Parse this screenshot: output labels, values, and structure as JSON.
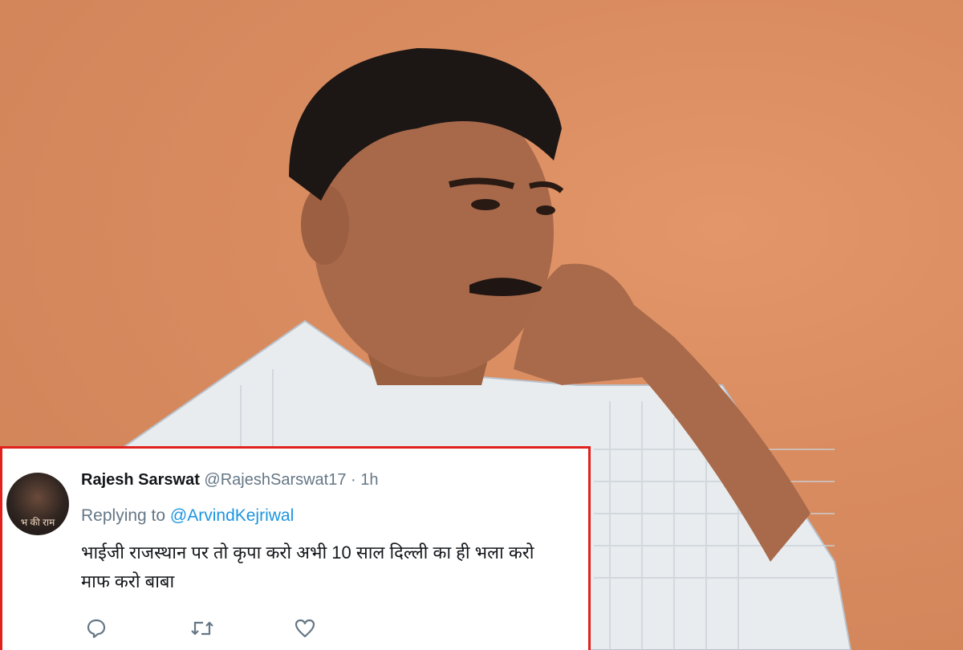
{
  "tweet": {
    "display_name": "Rajesh Sarswat",
    "handle": "@RajeshSarswat17",
    "separator": "·",
    "time": "1h",
    "replying_prefix": "Replying to",
    "replying_to": "@ArvindKejriwal",
    "text_line1": "भाईजी राजस्थान पर तो कृपा करो अभी 10 साल दिल्ली का ही भला करो",
    "text_line2": "माफ करो बाबा",
    "avatar_text": "भ की राम"
  },
  "actions": {
    "icons": [
      "reply-icon",
      "retweet-icon",
      "like-icon"
    ]
  },
  "colors": {
    "card_border": "#e0211d",
    "mention": "#1b95e0",
    "muted": "#657786",
    "background_wall": "#d98a5e"
  }
}
